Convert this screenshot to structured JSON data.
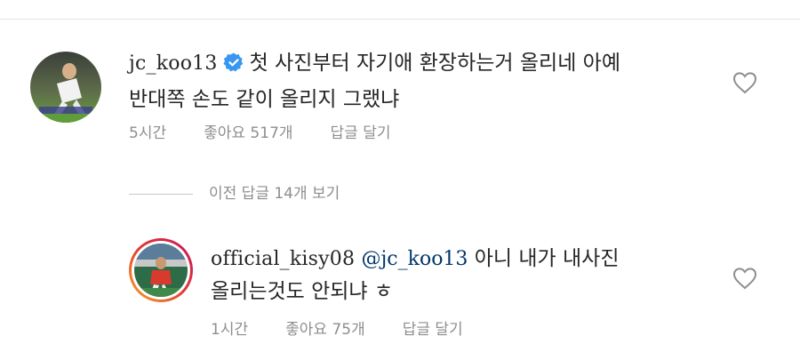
{
  "comments": [
    {
      "username": "jc_koo13",
      "verified": true,
      "text_line1": "첫 사진부터 자기애 환장하는거 올리네 아예",
      "text_line2": "반대쪽 손도 같이 올리지 그랬냐",
      "time": "5시간",
      "likes": "좋아요 517개",
      "reply": "답글 달기"
    }
  ],
  "view_replies": "이전 답글 14개 보기",
  "replies": [
    {
      "username": "official_kisy08",
      "mention": "@jc_koo13",
      "text_line1": "아니 내가 내사진",
      "text_line2": "올리는것도 안되냐 ㅎ",
      "time": "1시간",
      "likes": "좋아요 75개",
      "reply": "답글 달기"
    }
  ],
  "icons": {
    "heart": "heart-outline-icon",
    "verified": "verified-badge-icon"
  },
  "colors": {
    "text": "#262626",
    "meta": "#8e8e8e",
    "mention": "#00376b",
    "verified": "#3897f0",
    "story_ring_start": "#f9a825",
    "story_ring_end": "#c2185b"
  }
}
